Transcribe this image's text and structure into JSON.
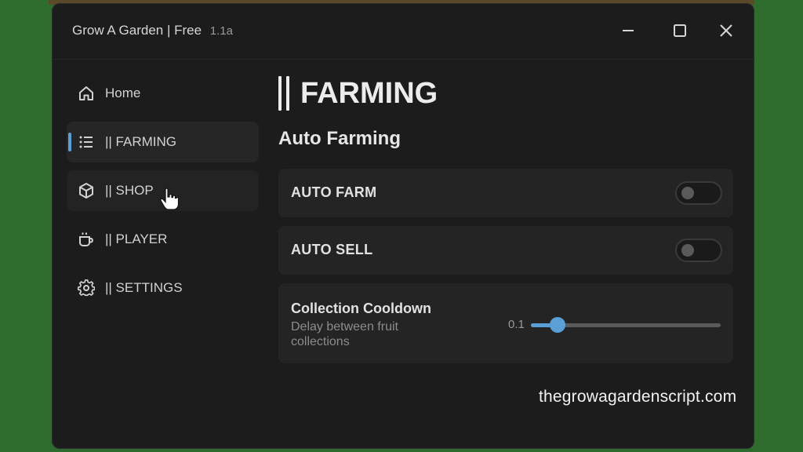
{
  "window": {
    "title": "Grow A Garden | Free",
    "version": "1.1a"
  },
  "sidebar": {
    "items": [
      {
        "label": "Home",
        "icon": "home-icon",
        "active": false
      },
      {
        "label": "|| FARMING",
        "icon": "list-icon",
        "active": true
      },
      {
        "label": "|| SHOP",
        "icon": "cube-icon",
        "active": false
      },
      {
        "label": "|| PLAYER",
        "icon": "cup-icon",
        "active": false
      },
      {
        "label": "|| SETTINGS",
        "icon": "gear-icon",
        "active": false
      }
    ]
  },
  "main": {
    "page_title": "FARMING",
    "section_title": "Auto Farming",
    "toggles": [
      {
        "label": "AUTO FARM",
        "on": false
      },
      {
        "label": "AUTO SELL",
        "on": false
      }
    ],
    "slider": {
      "title": "Collection Cooldown",
      "description": "Delay between fruit collections",
      "value_label": "0.1",
      "fraction": 0.14
    }
  },
  "watermark": "thegrowagardenscript.com",
  "colors": {
    "accent": "#5a9fd6",
    "window_bg": "#1c1c1c",
    "card_bg": "#242424",
    "page_bg": "#2e6b2e"
  }
}
